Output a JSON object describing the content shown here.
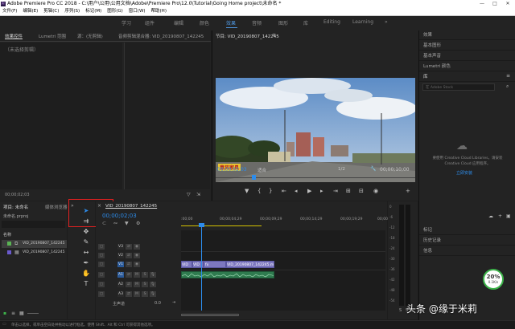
{
  "window": {
    "title": "Adobe Premiere Pro CC 2018 - C:\\用户\\公用\\公用文档\\Adobe\\Premiere Pro\\12.0\\Tutorial\\Going Home project\\未命名 *",
    "controls": [
      "—",
      "□",
      "✕"
    ]
  },
  "menu": [
    "文件(F)",
    "编辑(E)",
    "剪辑(C)",
    "序列(S)",
    "标记(M)",
    "图形(G)",
    "窗口(W)",
    "帮助(H)"
  ],
  "workspaces": {
    "items": [
      "学习",
      "组件",
      "编辑",
      "颜色",
      "效果",
      "音频",
      "图形",
      "库",
      "Editing",
      "Learning"
    ],
    "active": "效果",
    "more": "»"
  },
  "source_panel": {
    "tabs": [
      "效果控件",
      "Lumetri 范围",
      "源：(无剪辑)",
      "音频剪辑混合器: VID_20190807_142245"
    ],
    "empty_label": "（未选择剪辑）",
    "timecode": "00;00;02;03"
  },
  "program_panel": {
    "tab": "节目: VID_20190807_142245",
    "current_time": "00;00;02;03",
    "fit": "适合",
    "quality": "1/2",
    "duration": "00;00;10;00",
    "storefront_sign": "意风家具"
  },
  "right_panel": {
    "items": [
      "效果",
      "基本图形",
      "基本声音",
      "Lumetri 颜色",
      "库"
    ],
    "search_placeholder": "在 Adobe Stock",
    "cc_text": "要使用 Creative Cloud Libraries，请安装 Creative Cloud 应用程序。",
    "cc_link": "立即安装",
    "bottom_items": [
      "标记",
      "历史记录",
      "信息"
    ]
  },
  "project_panel": {
    "tabs": [
      "项目: 未命名",
      "媒体浏览器"
    ],
    "project_file": "未命名.prproj",
    "column_name": "名称",
    "items": [
      "VID_20190807_142245",
      "VID_20190807_142245"
    ]
  },
  "timeline": {
    "tab": "VID_20190807_142245",
    "timecode": "00;00;02;03",
    "ruler": [
      ":00;00",
      "00;00;04;29",
      "00;00;09;29",
      "00;00;14;29",
      "00;00;19;29",
      "00;00;24;29"
    ],
    "video_tracks": [
      "V3",
      "V2",
      "V1"
    ],
    "audio_tracks": [
      "A1",
      "A2",
      "A3"
    ],
    "master_label": "主声道",
    "master_value": "0.0",
    "video_clips": [
      "VID",
      "VID",
      "VID_20190807_142245.mp4 [V]"
    ]
  },
  "meters": {
    "scale": [
      "0",
      "-6",
      "-12",
      "-18",
      "-24",
      "-30",
      "-36",
      "-42",
      "-48",
      "-54"
    ],
    "bottom": [
      "S",
      "S"
    ]
  },
  "status_bar": {
    "text": "单击以选择，或单击空白处并拖动以进行框选。使用 Shift、Alt 和 Ctrl 可获得其他选项。"
  },
  "overlay": {
    "badge": "20%",
    "badge_sub": "0.1K/s",
    "watermark": "头条 @缘于米莉"
  }
}
